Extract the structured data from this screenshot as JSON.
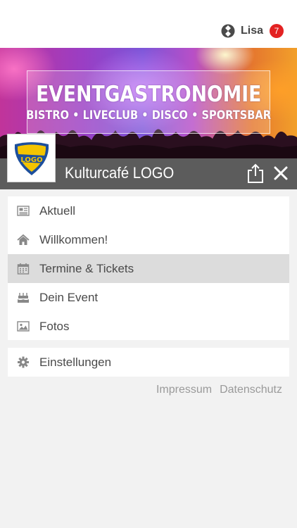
{
  "header": {
    "user_name": "Lisa",
    "notification_count": "7"
  },
  "banner": {
    "title": "EVENTGASTRONOMIE",
    "subtitle": "BISTRO • LIVECLUB • DISCO • SPORTSBAR"
  },
  "venue": {
    "name": "Kulturcafé LOGO",
    "logo_text": "LOGO"
  },
  "menu": {
    "items": [
      {
        "label": "Aktuell",
        "icon": "newspaper-icon",
        "active": false
      },
      {
        "label": "Willkommen!",
        "icon": "home-icon",
        "active": false
      },
      {
        "label": "Termine & Tickets",
        "icon": "calendar-icon",
        "active": true
      },
      {
        "label": "Dein Event",
        "icon": "cake-icon",
        "active": false
      },
      {
        "label": "Fotos",
        "icon": "image-icon",
        "active": false
      }
    ],
    "settings_label": "Einstellungen"
  },
  "footer": {
    "impressum": "Impressum",
    "datenschutz": "Datenschutz"
  },
  "colors": {
    "titlebar": "#5c5c5c",
    "badge": "#e32222",
    "active_item": "#dcdcdc",
    "logo_yellow": "#f4c400",
    "logo_blue": "#1d4f9c"
  }
}
